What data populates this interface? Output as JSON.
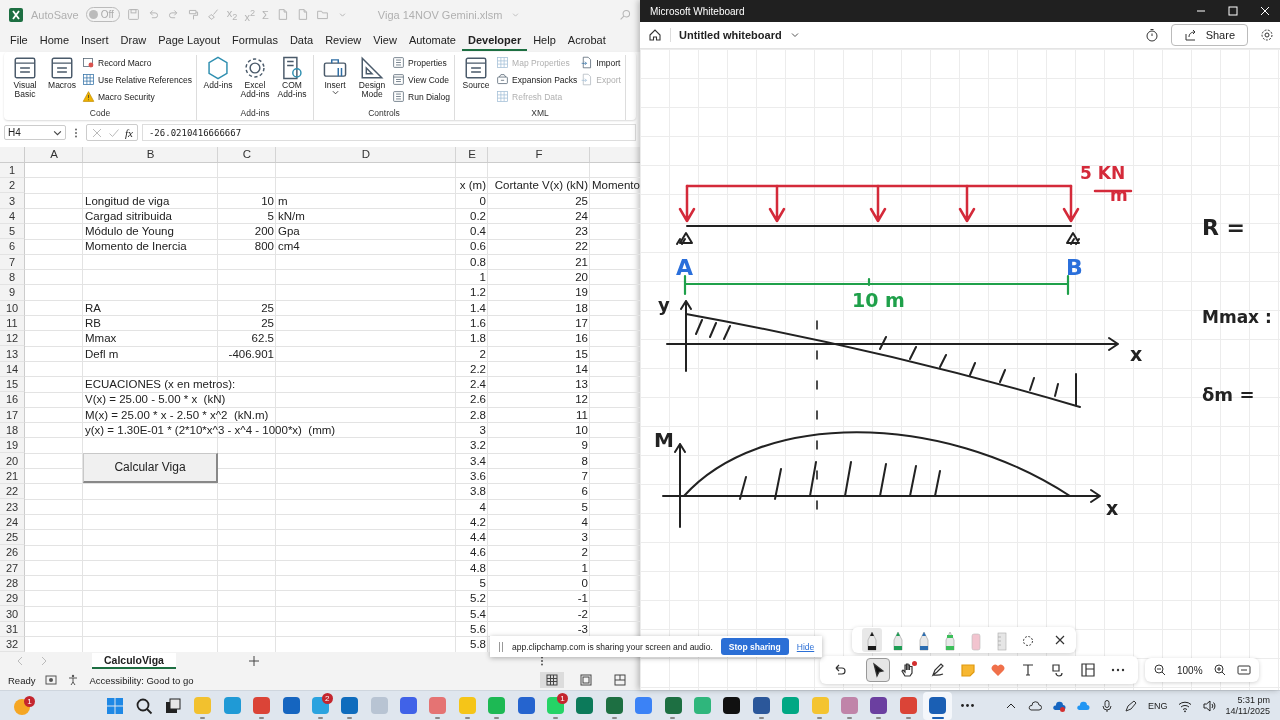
{
  "excel": {
    "title_bar": {
      "autosave_label": "AutoSave",
      "autosave_toggle": {
        "label": "Off",
        "on": false
      },
      "file_name": "Viga 14NOV Gemini.xlsm",
      "quick_access": [
        {
          "kind": "save"
        },
        {
          "kind": "undo"
        },
        {
          "kind": "redo"
        },
        {
          "kind": "brush"
        },
        {
          "kind": "broom"
        },
        {
          "kind": "glyph",
          "text": "x$_{2}$"
        },
        {
          "kind": "glyph",
          "text": "x$^{2}$"
        },
        {
          "kind": "glyph",
          "text": "Σ"
        },
        {
          "kind": "page"
        },
        {
          "kind": "page"
        },
        {
          "kind": "folder"
        },
        {
          "kind": "caret"
        }
      ]
    },
    "menu_tabs": [
      {
        "label": "File",
        "selected": false
      },
      {
        "label": "Home",
        "selected": false
      },
      {
        "label": "Insert",
        "selected": false
      },
      {
        "label": "Draw",
        "selected": false
      },
      {
        "label": "Page Layout",
        "selected": false
      },
      {
        "label": "Formulas",
        "selected": false
      },
      {
        "label": "Data",
        "selected": false
      },
      {
        "label": "Review",
        "selected": false
      },
      {
        "label": "View",
        "selected": false
      },
      {
        "label": "Automate",
        "selected": false
      },
      {
        "label": "Developer",
        "selected": true
      },
      {
        "label": "Help",
        "selected": false
      },
      {
        "label": "Acrobat",
        "selected": false
      }
    ],
    "ribbon_groups": [
      {
        "label": "Code",
        "items": [
          {
            "label": "Visual Basic",
            "kind": "large",
            "disabled": false
          },
          {
            "label": "Macros",
            "kind": "large",
            "disabled": false
          },
          {
            "label": "Record Macro",
            "kind": "small",
            "disabled": false
          },
          {
            "label": "Use Relative References",
            "kind": "small",
            "disabled": false
          },
          {
            "label": "Macro Security",
            "kind": "small",
            "disabled": false
          }
        ]
      },
      {
        "label": "Add-ins",
        "items": [
          {
            "label": "Add-ins",
            "kind": "large",
            "disabled": false
          },
          {
            "label": "Excel Add-ins",
            "kind": "large",
            "disabled": false
          },
          {
            "label": "COM Add-ins",
            "kind": "large",
            "disabled": false
          }
        ]
      },
      {
        "label": "Controls",
        "items": [
          {
            "label": "Insert",
            "kind": "large",
            "disabled": false
          },
          {
            "label": "Design Mode",
            "kind": "large",
            "disabled": false
          },
          {
            "label": "Properties",
            "kind": "small",
            "disabled": false
          },
          {
            "label": "View Code",
            "kind": "small",
            "disabled": false
          },
          {
            "label": "Run Dialog",
            "kind": "small",
            "disabled": false
          }
        ]
      },
      {
        "label": "XML",
        "items": [
          {
            "label": "Source",
            "kind": "large",
            "disabled": false
          },
          {
            "label": "Map Properties",
            "kind": "small",
            "disabled": true
          },
          {
            "label": "Expansion Packs",
            "kind": "small",
            "disabled": false
          },
          {
            "label": "Refresh Data",
            "kind": "small",
            "disabled": true
          },
          {
            "label": "Import",
            "kind": "small",
            "disabled": false
          },
          {
            "label": "Export",
            "kind": "small",
            "disabled": true
          }
        ]
      }
    ],
    "name_box": "H4",
    "function_label": "fx",
    "formula": "-26.0210416666667",
    "columns": [
      "A",
      "B",
      "C",
      "D",
      "E",
      "F"
    ],
    "rows": [
      {
        "number": "1"
      },
      {
        "number": "2",
        "e": "x (m)",
        "f": "Cortante V(x) (kN)",
        "g": "Momento"
      },
      {
        "number": "3",
        "b": "Longitud de viga",
        "c": "10",
        "d": "m",
        "e": "0",
        "f": "25"
      },
      {
        "number": "4",
        "b": "Cargad sitribuida",
        "c": "5",
        "d": "kN/m",
        "e": "0.2",
        "f": "24"
      },
      {
        "number": "5",
        "b": "Módulo de Young",
        "c": "200",
        "d": "Gpa",
        "e": "0.4",
        "f": "23"
      },
      {
        "number": "6",
        "b": "Momento de Inercia",
        "c": "800",
        "d": "cm4",
        "e": "0.6",
        "f": "22"
      },
      {
        "number": "7",
        "e": "0.8",
        "f": "21"
      },
      {
        "number": "8",
        "e": "1",
        "f": "20"
      },
      {
        "number": "9",
        "e": "1.2",
        "f": "19"
      },
      {
        "number": "10",
        "b": "RA",
        "c": "25",
        "e": "1.4",
        "f": "18"
      },
      {
        "number": "11",
        "b": "RB",
        "c": "25",
        "e": "1.6",
        "f": "17"
      },
      {
        "number": "12",
        "b": "Mmax",
        "c": "62.5",
        "e": "1.8",
        "f": "16"
      },
      {
        "number": "13",
        "b": "Defl m",
        "c": "-406.901",
        "e": "2",
        "f": "15"
      },
      {
        "number": "14",
        "e": "2.2",
        "f": "14"
      },
      {
        "number": "15",
        "b": "ECUACIONES (x en metros):",
        "e": "2.4",
        "f": "13"
      },
      {
        "number": "16",
        "b": "V(x) = 25.00 - 5.00 * x  (kN)",
        "e": "2.6",
        "f": "12"
      },
      {
        "number": "17",
        "b": "M(x) = 25.00 * x - 2.50 * x^2  (kN.m)",
        "e": "2.8",
        "f": "11"
      },
      {
        "number": "18",
        "b": "y(x) = 1.30E-01 * (2*10*x^3 - x^4 - 1000*x)  (mm)",
        "e": "3",
        "f": "10"
      },
      {
        "number": "19",
        "e": "3.2",
        "f": "9"
      },
      {
        "number": "20",
        "e": "3.4",
        "f": "8"
      },
      {
        "number": "21",
        "e": "3.6",
        "f": "7"
      },
      {
        "number": "22",
        "e": "3.8",
        "f": "6"
      },
      {
        "number": "23",
        "e": "4",
        "f": "5"
      },
      {
        "number": "24",
        "e": "4.2",
        "f": "4"
      },
      {
        "number": "25",
        "e": "4.4",
        "f": "3"
      },
      {
        "number": "26",
        "e": "4.6",
        "f": "2"
      },
      {
        "number": "27",
        "e": "4.8",
        "f": "1"
      },
      {
        "number": "28",
        "e": "5",
        "f": "0"
      },
      {
        "number": "29",
        "e": "5.2",
        "f": "-1"
      },
      {
        "number": "30",
        "e": "5.4",
        "f": "-2"
      },
      {
        "number": "31",
        "e": "5.6",
        "f": "-3"
      },
      {
        "number": "32",
        "e": "5.8"
      }
    ],
    "macro_button": "Calcular Viga",
    "sheet_tabs": [
      {
        "label": "CalculoViga",
        "selected": true
      }
    ],
    "status": {
      "ready": "Ready",
      "accessibility": "Accessibility: Good to go",
      "views": [
        {
          "kind": "normal",
          "selected": true
        },
        {
          "kind": "page-layout",
          "selected": false
        },
        {
          "kind": "page-break",
          "selected": false
        }
      ]
    }
  },
  "whiteboard": {
    "window_title": "Microsoft Whiteboard",
    "board_title": "Untitled whiteboard",
    "share_label": "Share",
    "ink_labels": [
      {
        "text": "5 KN",
        "color": "#d42a3a"
      },
      {
        "text": "m",
        "color": "#d42a3a"
      },
      {
        "text": "R =",
        "color": "#222222"
      },
      {
        "text": "A",
        "color": "#2a6fdb"
      },
      {
        "text": "B",
        "color": "#2a6fdb"
      },
      {
        "text": "10 m",
        "color": "#1fa04a"
      },
      {
        "text": "y",
        "color": "#222222"
      },
      {
        "text": "Mmax :",
        "color": "#222222"
      },
      {
        "text": "x",
        "color": "#222222"
      },
      {
        "text": "δm =",
        "color": "#222222"
      },
      {
        "text": "M",
        "color": "#222222"
      },
      {
        "text": "x",
        "color": "#222222"
      }
    ],
    "pen_tray": [
      {
        "kind": "pen",
        "color": "#1a1a1a",
        "selected": true
      },
      {
        "kind": "pen",
        "color": "#1f9d55",
        "selected": false
      },
      {
        "kind": "pen",
        "color": "#2b6cb0",
        "selected": false
      },
      {
        "kind": "highlighter",
        "color": "#3cbf5a",
        "selected": false
      },
      {
        "kind": "eraser",
        "selected": false
      },
      {
        "kind": "ruler",
        "selected": false
      },
      {
        "kind": "lasso",
        "selected": false
      }
    ],
    "tools": [
      {
        "kind": "undo",
        "selected": false,
        "dot": false
      },
      {
        "kind": "select",
        "selected": true,
        "dot": false
      },
      {
        "kind": "hand",
        "selected": false,
        "dot": true
      },
      {
        "kind": "pen",
        "selected": false,
        "dot": false
      },
      {
        "kind": "note",
        "selected": false,
        "dot": false
      },
      {
        "kind": "reaction",
        "selected": false,
        "dot": false
      },
      {
        "kind": "text",
        "selected": false,
        "dot": false
      },
      {
        "kind": "shapes",
        "selected": false,
        "dot": false
      },
      {
        "kind": "templates",
        "selected": false,
        "dot": false
      },
      {
        "kind": "more",
        "selected": false,
        "dot": false
      }
    ],
    "zoom_label": "100%"
  },
  "sharing_bar": {
    "message": "app.clipchamp.com is sharing your screen and audio.",
    "stop_label": "Stop sharing",
    "hide_label": "Hide"
  },
  "taskbar": {
    "widget_badge": "1",
    "items": [
      {
        "kind": "start",
        "running": false,
        "selected": false
      },
      {
        "kind": "search",
        "running": false,
        "selected": false
      },
      {
        "kind": "taskview",
        "running": false,
        "selected": false
      },
      {
        "kind": "app",
        "running": true,
        "selected": false
      },
      {
        "kind": "app",
        "running": false,
        "selected": false
      },
      {
        "kind": "app",
        "running": true,
        "selected": false
      },
      {
        "kind": "app",
        "running": false,
        "selected": false
      },
      {
        "kind": "app",
        "running": true,
        "selected": false,
        "badge": "2"
      },
      {
        "kind": "app",
        "running": true,
        "selected": false
      },
      {
        "kind": "app",
        "running": false,
        "selected": false
      },
      {
        "kind": "app",
        "running": false,
        "selected": false
      },
      {
        "kind": "app",
        "running": true,
        "selected": false
      },
      {
        "kind": "app",
        "running": true,
        "selected": false
      },
      {
        "kind": "app",
        "running": true,
        "selected": false
      },
      {
        "kind": "app",
        "running": false,
        "selected": false
      },
      {
        "kind": "app",
        "running": true,
        "selected": false,
        "badge": "1"
      },
      {
        "kind": "app",
        "running": false,
        "selected": false
      },
      {
        "kind": "app",
        "running": true,
        "selected": false
      },
      {
        "kind": "app",
        "running": false,
        "selected": false
      },
      {
        "kind": "app",
        "running": true,
        "selected": false
      },
      {
        "kind": "app",
        "running": false,
        "selected": false
      },
      {
        "kind": "app",
        "running": false,
        "selected": false
      },
      {
        "kind": "app",
        "running": true,
        "selected": false
      },
      {
        "kind": "app",
        "running": false,
        "selected": false
      },
      {
        "kind": "app",
        "running": true,
        "selected": false
      },
      {
        "kind": "app",
        "running": true,
        "selected": false
      },
      {
        "kind": "app",
        "running": true,
        "selected": false
      },
      {
        "kind": "app",
        "running": true,
        "selected": false
      },
      {
        "kind": "app",
        "running": true,
        "selected": true
      },
      {
        "kind": "more",
        "running": false,
        "selected": false
      }
    ],
    "language": "ENG",
    "time": "5:31 pm",
    "date": "14/11/2025"
  }
}
